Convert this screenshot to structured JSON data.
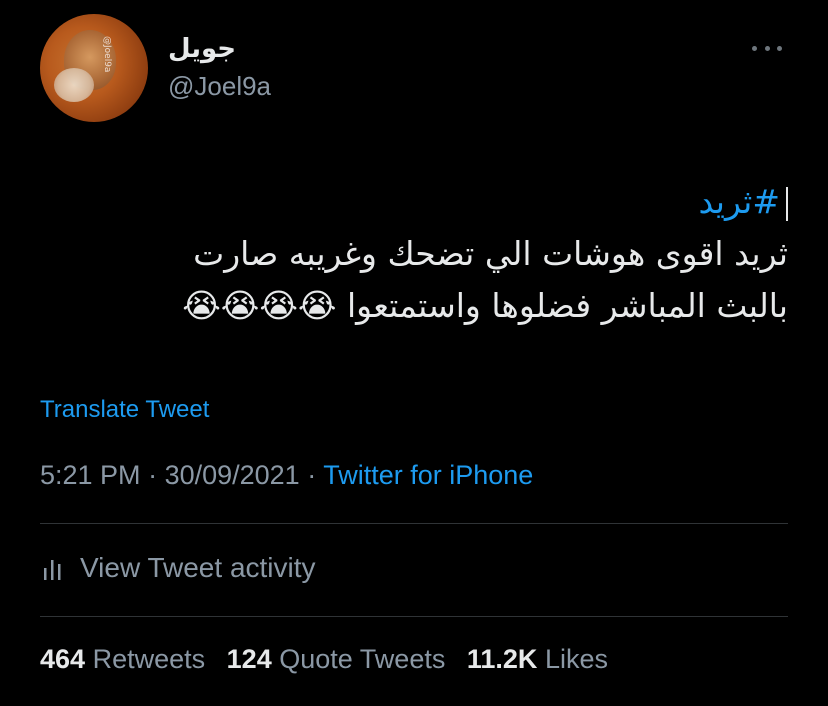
{
  "tweet": {
    "author": {
      "display_name": "جويل",
      "handle": "@Joel9a",
      "avatar_watermark": "@Joel9a"
    },
    "more_icon": "more-horizontal-icon",
    "text": {
      "hashtag": "#ثريد",
      "line1": "ثريد اقوى هوشات الي  تضحك وغريبه صارت",
      "line2": "بالبث المباشر فضلوها واستمتعوا",
      "emojis": "😭😭😭😭"
    },
    "translate_label": "Translate Tweet",
    "time": "5:21 PM",
    "separator": " · ",
    "date": "30/09/2021",
    "source": "Twitter for iPhone",
    "activity": {
      "icon": "bar-chart-icon",
      "label": "View Tweet activity"
    },
    "stats": {
      "retweets_count": "464",
      "retweets_label": "Retweets",
      "quotes_count": "124",
      "quotes_label": "Quote Tweets",
      "likes_count": "11.2K",
      "likes_label": "Likes"
    }
  },
  "colors": {
    "background": "#000000",
    "text_primary": "#e7e9ea",
    "text_secondary": "#8b98a5",
    "accent": "#1d9bf0",
    "divider": "#2f3336"
  }
}
